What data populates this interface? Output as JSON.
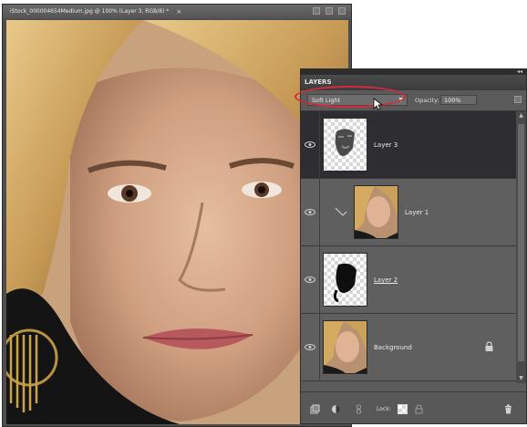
{
  "document": {
    "title": "iStock_000004654Medium.jpg @ 100% (Layer 3, RGB/8) *",
    "close_glyph": "×"
  },
  "layers_panel": {
    "tab_label": "LAYERS",
    "collapse_glyph": "◂◂",
    "blend_mode": "Soft Light",
    "opacity_label": "Opacity:",
    "opacity_value": "100%",
    "lock_label": "Lock:",
    "layers": [
      {
        "name": "Layer 3",
        "selected": true,
        "thumb": "mask-face"
      },
      {
        "name": "Layer 1",
        "selected": false,
        "thumb": "photo"
      },
      {
        "name": "Layer 2",
        "selected": false,
        "thumb": "mask-dark"
      },
      {
        "name": "Background",
        "selected": false,
        "thumb": "photo",
        "locked": true
      }
    ]
  },
  "colors": {
    "highlight_ring": "#d42a3a",
    "selected_row": "#2e2e32",
    "panel_bg": "#5c5c5c"
  },
  "icons": [
    "eye-icon",
    "lock-icon",
    "trash-icon",
    "new-layer-icon",
    "adjustment-layer-icon",
    "link-icon",
    "lock-transparency-icon",
    "cursor-arrow-icon"
  ]
}
